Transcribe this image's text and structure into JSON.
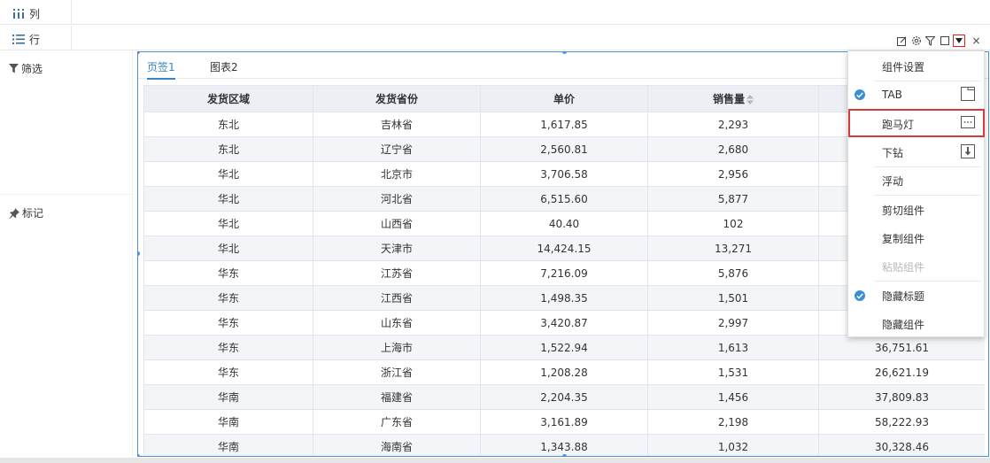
{
  "shelves": {
    "columns_label": "列",
    "rows_label": "行"
  },
  "left_panel": {
    "filter_label": "筛选",
    "mark_label": "标记"
  },
  "widget": {
    "tabs": [
      {
        "label": "页签1",
        "active": true
      },
      {
        "label": "图表2",
        "active": false
      }
    ],
    "table": {
      "headers": [
        "发货区域",
        "发货省份",
        "单价",
        "销售量",
        ""
      ],
      "rows": [
        [
          "东北",
          "吉林省",
          "1,617.85",
          "2,293",
          ""
        ],
        [
          "东北",
          "辽宁省",
          "2,560.81",
          "2,680",
          ""
        ],
        [
          "华北",
          "北京市",
          "3,706.58",
          "2,956",
          ""
        ],
        [
          "华北",
          "河北省",
          "6,515.60",
          "5,877",
          ""
        ],
        [
          "华北",
          "山西省",
          "40.40",
          "102",
          ""
        ],
        [
          "华北",
          "天津市",
          "14,424.15",
          "13,271",
          ""
        ],
        [
          "华东",
          "江苏省",
          "7,216.09",
          "5,876",
          ""
        ],
        [
          "华东",
          "江西省",
          "1,498.35",
          "1,501",
          ""
        ],
        [
          "华东",
          "山东省",
          "3,420.87",
          "2,997",
          ""
        ],
        [
          "华东",
          "上海市",
          "1,522.94",
          "1,613",
          "36,751.61"
        ],
        [
          "华东",
          "浙江省",
          "1,208.28",
          "1,531",
          "26,621.19"
        ],
        [
          "华南",
          "福建省",
          "2,204.35",
          "1,456",
          "37,809.83"
        ],
        [
          "华南",
          "广东省",
          "3,161.89",
          "2,198",
          "58,222.93"
        ],
        [
          "华南",
          "海南省",
          "1,343.88",
          "1,032",
          "30,328.46"
        ]
      ]
    }
  },
  "toolbar": {
    "icons": [
      "edit-icon",
      "gear-icon",
      "filter-icon",
      "maximize-icon",
      "dropdown-icon"
    ],
    "close_label": "×"
  },
  "menu": {
    "items": [
      {
        "label": "组件设置",
        "checked": false,
        "disabled": false
      },
      {
        "label": "TAB",
        "checked": true,
        "disabled": false
      },
      {
        "label": "跑马灯",
        "checked": false,
        "disabled": false
      },
      {
        "label": "下钻",
        "checked": false,
        "disabled": false
      },
      {
        "label": "浮动",
        "checked": false,
        "disabled": false
      },
      {
        "label": "剪切组件",
        "checked": false,
        "disabled": false
      },
      {
        "label": "复制组件",
        "checked": false,
        "disabled": false
      },
      {
        "label": "粘贴组件",
        "checked": false,
        "disabled": true
      },
      {
        "label": "隐藏标题",
        "checked": true,
        "disabled": false
      },
      {
        "label": "隐藏组件",
        "checked": false,
        "disabled": false
      }
    ],
    "highlighted_item": "跑马灯"
  },
  "colors": {
    "accent": "#3685c9",
    "selection_border": "#4a90d9",
    "highlight_red": "#d63b3b"
  }
}
